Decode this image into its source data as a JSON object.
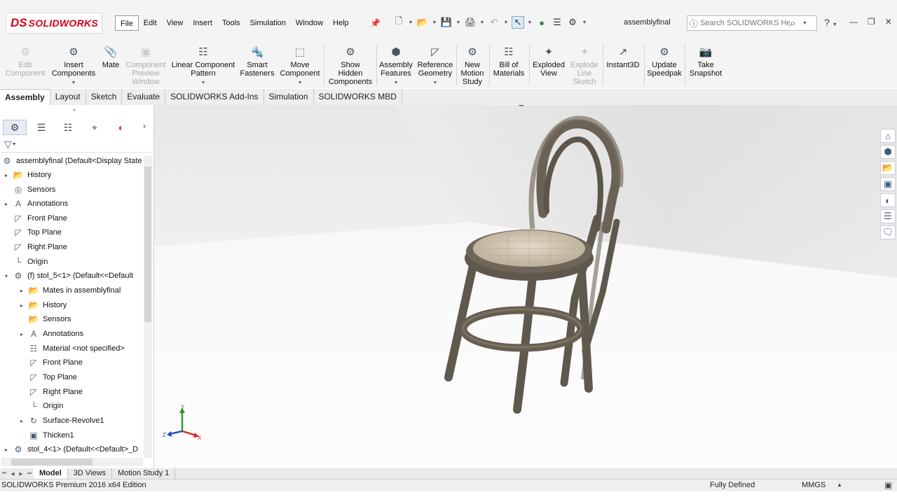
{
  "app": {
    "logo_mark": "DS",
    "logo_text": "SOLIDWORKS",
    "doc_title": "assemblyfinal"
  },
  "menus": [
    "File",
    "Edit",
    "View",
    "Insert",
    "Tools",
    "Simulation",
    "Window",
    "Help"
  ],
  "search": {
    "placeholder": "Search SOLIDWORKS Help"
  },
  "ribbon": {
    "edit_component": "Edit\nComponent",
    "insert_components": "Insert\nComponents",
    "mate": "Mate",
    "component_preview": "Component\nPreview\nWindow",
    "linear_pattern": "Linear Component\nPattern",
    "smart_fasteners": "Smart\nFasteners",
    "move_component": "Move\nComponent",
    "show_hidden": "Show\nHidden\nComponents",
    "assembly_features": "Assembly\nFeatures",
    "reference_geometry": "Reference\nGeometry",
    "new_motion_study": "New\nMotion\nStudy",
    "bill_of_materials": "Bill of\nMaterials",
    "exploded_view": "Exploded\nView",
    "explode_line_sketch": "Explode\nLine\nSketch",
    "instant3d": "Instant3D",
    "update_speedpak": "Update\nSpeedpak",
    "take_snapshot": "Take\nSnapshot"
  },
  "tabs": [
    "Assembly",
    "Layout",
    "Sketch",
    "Evaluate",
    "SOLIDWORKS Add-Ins",
    "Simulation",
    "SOLIDWORKS MBD"
  ],
  "tree": {
    "root": "assemblyfinal  (Default<Display State",
    "history": "History",
    "sensors": "Sensors",
    "annotations": "Annotations",
    "front_plane": "Front Plane",
    "top_plane": "Top Plane",
    "right_plane": "Right Plane",
    "origin": "Origin",
    "stol5": "(f) stol_5<1> (Default<<Default",
    "mates": "Mates in assemblyfinal",
    "c_history": "History",
    "c_sensors": "Sensors",
    "c_annotations": "Annotations",
    "material": "Material <not specified>",
    "c_front_plane": "Front Plane",
    "c_top_plane": "Top Plane",
    "c_right_plane": "Right Plane",
    "c_origin": "Origin",
    "surface_revolve": "Surface-Revolve1",
    "thicken": "Thicken1",
    "stol4": "stol_4<1> (Default<<Default>_D"
  },
  "triad": {
    "y": "Y",
    "z": "Z",
    "x": "X"
  },
  "bottom_tabs": [
    "Model",
    "3D Views",
    "Motion Study 1"
  ],
  "status": {
    "edition": "SOLIDWORKS Premium 2016 x64 Edition",
    "definition": "Fully Defined",
    "units": "MMGS"
  },
  "colors": {
    "brand": "#d6001c",
    "chair_wood": "#6b6355",
    "chair_seat": "#d8cdbb"
  }
}
